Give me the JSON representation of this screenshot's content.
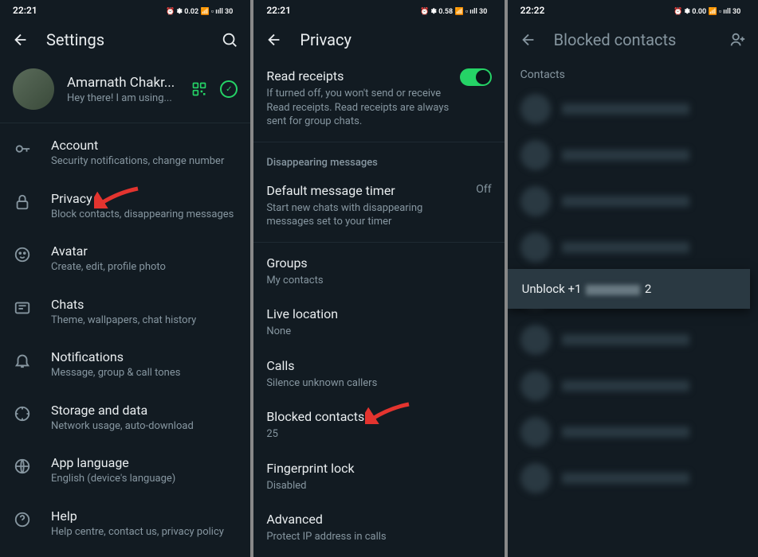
{
  "statusbar": {
    "time1": "22:21",
    "time2": "22:21",
    "time3": "22:22",
    "indicators": "⏰ ✽ 0.02 📶 📶 ⬜ 30"
  },
  "screen1": {
    "title": "Settings",
    "profile": {
      "name": "Amarnath Chakr...",
      "status": "Hey there! I am using..."
    },
    "items": [
      {
        "title": "Account",
        "sub": "Security notifications, change number"
      },
      {
        "title": "Privacy",
        "sub": "Block contacts, disappearing messages"
      },
      {
        "title": "Avatar",
        "sub": "Create, edit, profile photo"
      },
      {
        "title": "Chats",
        "sub": "Theme, wallpapers, chat history"
      },
      {
        "title": "Notifications",
        "sub": "Message, group & call tones"
      },
      {
        "title": "Storage and data",
        "sub": "Network usage, auto-download"
      },
      {
        "title": "App language",
        "sub": "English (device's language)"
      },
      {
        "title": "Help",
        "sub": "Help centre, contact us, privacy policy"
      }
    ]
  },
  "screen2": {
    "title": "Privacy",
    "read_receipts": {
      "title": "Read receipts",
      "sub": "If turned off, you won't send or receive Read receipts. Read receipts are always sent for group chats."
    },
    "section_disappearing": "Disappearing messages",
    "default_timer": {
      "title": "Default message timer",
      "sub": "Start new chats with disappearing messages set to your timer",
      "value": "Off"
    },
    "groups": {
      "title": "Groups",
      "sub": "My contacts"
    },
    "live_location": {
      "title": "Live location",
      "sub": "None"
    },
    "calls": {
      "title": "Calls",
      "sub": "Silence unknown callers"
    },
    "blocked": {
      "title": "Blocked contacts",
      "sub": "25"
    },
    "fingerprint": {
      "title": "Fingerprint lock",
      "sub": "Disabled"
    },
    "advanced": {
      "title": "Advanced",
      "sub": "Protect IP address in calls"
    }
  },
  "screen3": {
    "title": "Blocked contacts",
    "contacts_label": "Contacts",
    "popup_prefix": "Unblock +1",
    "popup_suffix": "2"
  }
}
